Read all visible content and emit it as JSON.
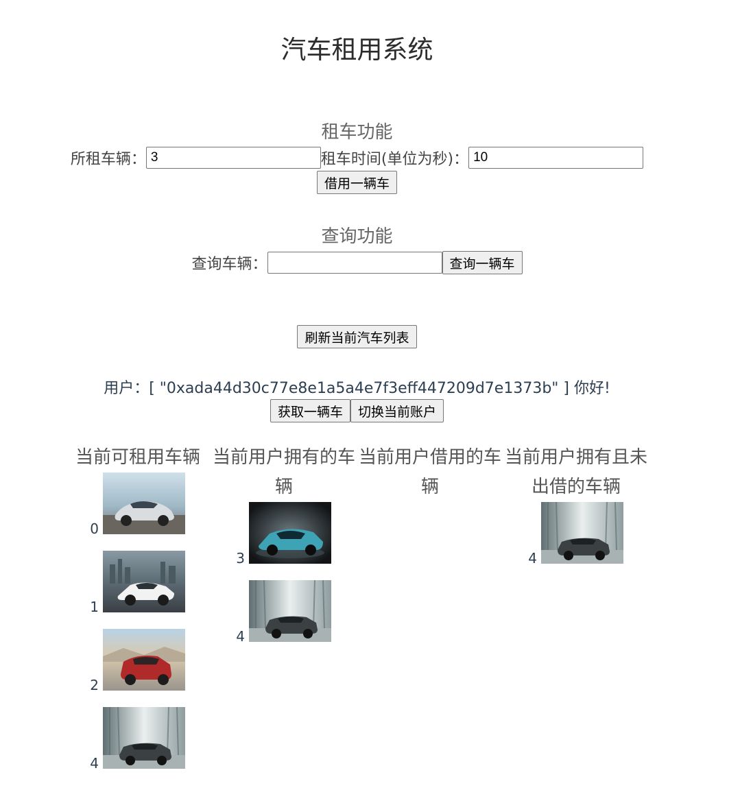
{
  "page": {
    "title": "汽车租用系统"
  },
  "rent": {
    "heading": "租车功能",
    "car_label": "所租车辆：",
    "car_value": "3",
    "time_label": "租车时间(单位为秒)：",
    "time_value": "10",
    "button": "借用一辆车"
  },
  "query": {
    "heading": "查询功能",
    "car_label": "查询车辆：",
    "car_value": "",
    "button": "查询一辆车"
  },
  "refresh_button": "刷新当前汽车列表",
  "user": {
    "text": "用户：[ \"0xada44d30c77e8e1a5a4e7f3eff447209d7e1373b\" ] 你好!",
    "get_button": "获取一辆车",
    "switch_button": "切换当前账户"
  },
  "columns": [
    {
      "title": "当前可租用车辆",
      "cars": [
        {
          "id": "0",
          "image": "porsche-silver"
        },
        {
          "id": "1",
          "image": "lamborghini-white"
        },
        {
          "id": "2",
          "image": "bmw-red"
        },
        {
          "id": "4",
          "image": "bentley-grey"
        }
      ]
    },
    {
      "title": "当前用户拥有的车辆",
      "cars": [
        {
          "id": "3",
          "image": "concept-teal"
        },
        {
          "id": "4",
          "image": "bentley-grey"
        }
      ]
    },
    {
      "title": "当前用户借用的车辆",
      "cars": []
    },
    {
      "title": "当前用户拥有且未出借的车辆",
      "cars": [
        {
          "id": "4",
          "image": "bentley-grey"
        }
      ]
    }
  ]
}
